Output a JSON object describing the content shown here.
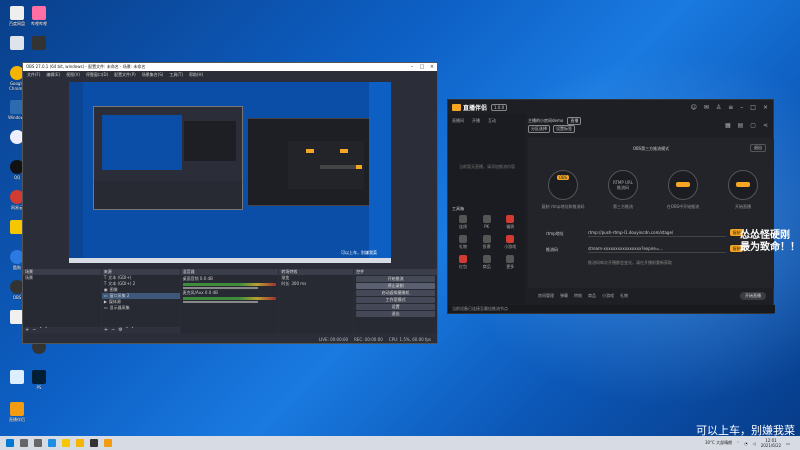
{
  "desktop": {
    "icons": [
      {
        "label": "百度网盘",
        "color": "#4a90e2",
        "icon": "cloud-icon"
      },
      {
        "label": "哔哩哔哩",
        "color": "#ff6fa3",
        "icon": "bilibili-icon"
      },
      {
        "label": "Google Chrome",
        "color": "#f4b400",
        "icon": "chrome-icon"
      },
      {
        "label": "Windows",
        "color": "#2b6cb0",
        "icon": "windows-icon"
      },
      {
        "label": "QQ",
        "color": "#111111",
        "icon": "qq-icon"
      },
      {
        "label": "网易云",
        "color": "#d33a31",
        "icon": "music-icon"
      },
      {
        "label": "酷狗",
        "color": "#2a7ae2",
        "icon": "kugou-icon"
      },
      {
        "label": "OBS",
        "color": "#333333",
        "icon": "obs-icon"
      },
      {
        "label": "PS",
        "color": "#001e36",
        "icon": "photoshop-icon"
      },
      {
        "label": "直播伴侣",
        "color": "#f39c12",
        "icon": "live-icon"
      }
    ]
  },
  "obs": {
    "title": "OBS 27.0.1 (64 bit, windows) - 配置文件: 未命名 - 场景: 未命名",
    "menu": [
      "文件(F)",
      "编辑(E)",
      "视图(V)",
      "停靠窗口(D)",
      "配置文件(P)",
      "场景集合(S)",
      "工具(T)",
      "帮助(H)"
    ],
    "docks": {
      "scenes_title": "场景",
      "scenes": [
        "场景"
      ],
      "sources_title": "来源",
      "sources": [
        "文本 (GDI+)",
        "文本 (GDI+) 2",
        "图像",
        "窗口采集 2",
        "媒体源",
        "显示器采集"
      ],
      "mixer_title": "混音器",
      "mixer": [
        {
          "name": "桌面音频",
          "level": "0.0 dB"
        },
        {
          "name": "麦克风/Aux",
          "level": "0.0 dB"
        }
      ],
      "transition_title": "转场特效",
      "transition_name": "渐变",
      "transition_duration_label": "时长",
      "transition_duration": "300 ms",
      "controls_title": "控件",
      "controls": [
        "开始推流",
        "停止录制",
        "启动虚拟摄像机",
        "工作室模式",
        "设置",
        "退出"
      ]
    },
    "status": {
      "live": "LIVE: 00:00:00",
      "rec": "REC: 00:00:00",
      "cpu": "CPU: 1.5%, 60.00 fps"
    },
    "canvas_overlay": "可以上车，别嫌我菜"
  },
  "live": {
    "app_name": "直播伴侣",
    "version": "1.0.0",
    "header_icons": [
      "user-icon",
      "mail-icon",
      "shirt-icon",
      "menu-icon",
      "minimize-icon",
      "maximize-icon",
      "close-icon"
    ],
    "tabs": [
      "直播间",
      "开播",
      "互动"
    ],
    "room_title": "主播的小房间demo",
    "room_badge": "直播",
    "room_tags": [
      "分区选择",
      "设置标签"
    ],
    "sidebar_tip": "当前暂无直播，请添加推流内容",
    "mode_title": "OBS第三方推流模式",
    "exit_label": "退出",
    "steps": [
      {
        "pill": "OBS",
        "label": "复制 rtmp地址和推流码"
      },
      {
        "pill": "",
        "label": "第三方推流"
      },
      {
        "pill": "",
        "label": "在OBS中开始推流"
      },
      {
        "pill": "",
        "label": "开始直播"
      }
    ],
    "step_center_texts": [
      "RTMP URL",
      "推流码"
    ],
    "fields": [
      {
        "label": "rtmp地址",
        "value": "rtmp://push-rtmp-l1.douyincdn.com/stage/",
        "button": "复制"
      },
      {
        "label": "推流码",
        "value": "stream-xxxxxxxxxxxxxxxx?expire=...",
        "button": "复制"
      }
    ],
    "field_note": "推流码每次开播都会变化，请在开播前重新获取",
    "tools_title": "工具箱",
    "tools": [
      "连线",
      "PK",
      "福袋",
      "礼物",
      "投票",
      "小游戏",
      "红包",
      "商品",
      "更多"
    ],
    "bottom": [
      "房间管理",
      "弹幕",
      "特效",
      "商品",
      "小游戏",
      "礼物",
      "开始直播"
    ],
    "footer": "当前设备已连接至最佳推流节点"
  },
  "overlay_text_1": "怂怂怪硬刚",
  "overlay_text_2": "最为致命！！",
  "watermark": "可以上车，别嫌我菜",
  "taskbar": {
    "weather": "30°C 大部晴朗",
    "time": "12:01",
    "date": "2021/6/22"
  }
}
